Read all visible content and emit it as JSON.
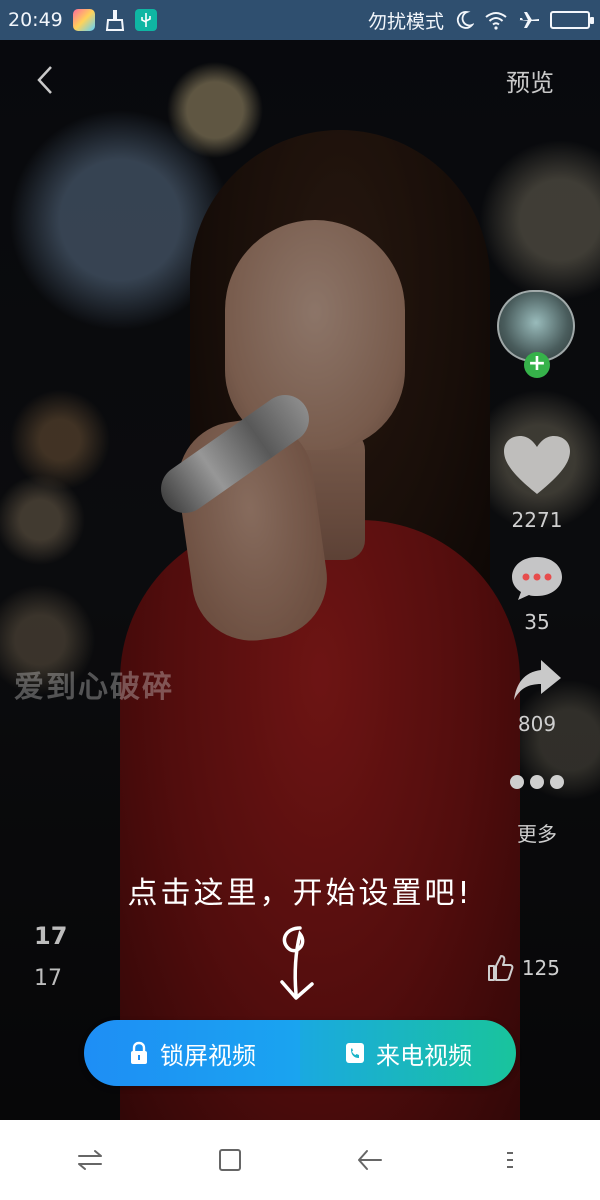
{
  "status_bar": {
    "time": "20:49",
    "dnd_label": "勿扰模式",
    "icons": [
      "app-icon",
      "broom-icon",
      "usb-icon",
      "moon-icon",
      "wifi-icon",
      "airplane-icon",
      "battery-icon"
    ]
  },
  "header": {
    "back_icon": "chevron-left-icon",
    "preview_label": "预览"
  },
  "right_rail": {
    "likes": "2271",
    "comments": "35",
    "shares": "809",
    "more_label": "更多"
  },
  "video": {
    "watermark": "爱到心破碎"
  },
  "hint": {
    "text": "点击这里，开始设置吧!"
  },
  "bottom_counts": {
    "bold_count": "17",
    "normal_count": "17",
    "thumb_count": "125"
  },
  "actions": {
    "lock_screen_label": "锁屏视频",
    "call_video_label": "来电视频"
  },
  "colors": {
    "status_bar": "#2f4f6f",
    "lock_button": "#1e8ef5",
    "call_button": "#19c49c",
    "follow_plus": "#36b24a",
    "comment_bubble": "#e74c4c"
  }
}
